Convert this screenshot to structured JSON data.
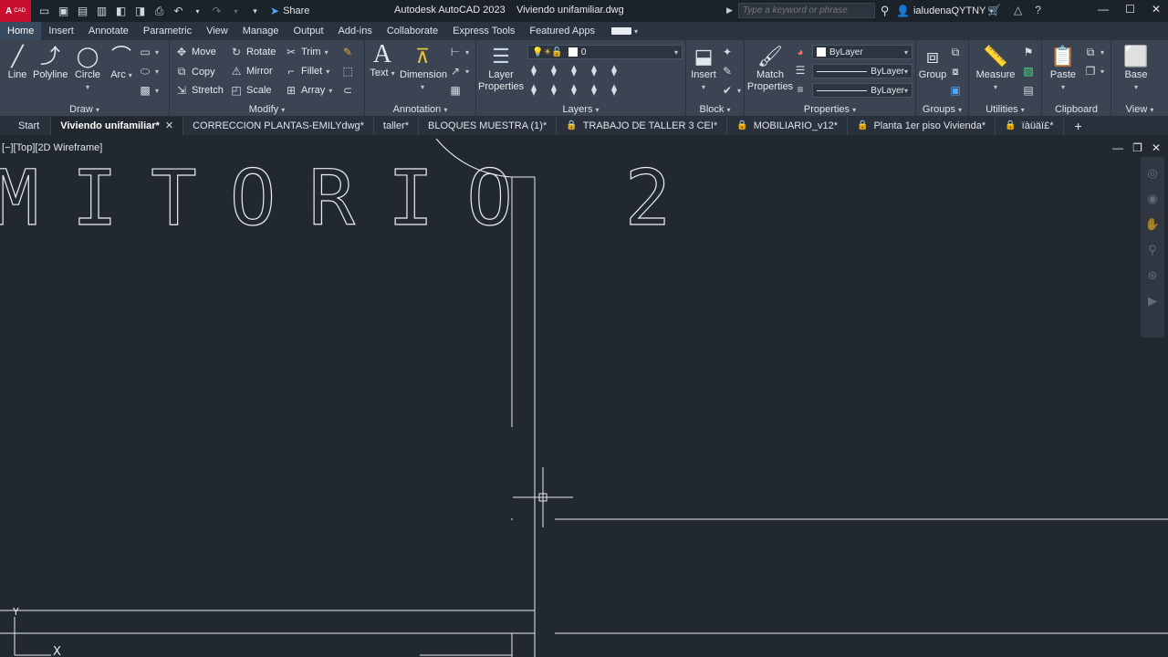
{
  "app": {
    "logo_letter": "A",
    "logo_sub": "CAD",
    "title": "Autodesk AutoCAD 2023",
    "file": "Viviendo unifamiliar.dwg",
    "share_label": "Share",
    "search_placeholder": "Type a keyword or phrase",
    "user": "ialudenaQYTNY"
  },
  "ribbon_tabs": [
    "Home",
    "Insert",
    "Annotate",
    "Parametric",
    "View",
    "Manage",
    "Output",
    "Add-ins",
    "Collaborate",
    "Express Tools",
    "Featured Apps"
  ],
  "draw": {
    "title": "Draw",
    "line": "Line",
    "polyline": "Polyline",
    "circle": "Circle",
    "arc": "Arc"
  },
  "modify": {
    "title": "Modify",
    "move": "Move",
    "rotate": "Rotate",
    "trim": "Trim",
    "copy": "Copy",
    "mirror": "Mirror",
    "fillet": "Fillet",
    "stretch": "Stretch",
    "scale": "Scale",
    "array": "Array"
  },
  "annotation": {
    "title": "Annotation",
    "text": "Text",
    "dimension": "Dimension"
  },
  "layers": {
    "title": "Layers",
    "layer_properties_1": "Layer",
    "layer_properties_2": "Properties",
    "current_layer": "0"
  },
  "block": {
    "title": "Block",
    "insert": "Insert"
  },
  "properties": {
    "title": "Properties",
    "match_1": "Match",
    "match_2": "Properties",
    "color": "ByLayer",
    "linetype": "ByLayer",
    "lineweight": "ByLayer"
  },
  "groups": {
    "title": "Groups",
    "group": "Group"
  },
  "utilities": {
    "title": "Utilities",
    "measure": "Measure"
  },
  "clipboard": {
    "title": "Clipboard",
    "paste": "Paste"
  },
  "view": {
    "title": "View",
    "base": "Base"
  },
  "file_tabs": {
    "start": "Start",
    "active": "Viviendo unifamiliar*",
    "t1": "CORRECCION PLANTAS-EMILYdwg*",
    "t2": "taller*",
    "t3": "BLOQUES MUESTRA (1)*",
    "t4": "TRABAJO DE TALLER 3 CEI*",
    "t5": "MOBILIARIO_v12*",
    "t6": "Planta 1er piso Vivienda*",
    "t7": "ïàüäï£*"
  },
  "viewport": {
    "label": "[−][Top][2D Wireframe]",
    "room_text": "MITORIO 2",
    "ucs_y": "Y",
    "ucs_x": "X"
  },
  "colors": {
    "canvas": "#212830",
    "ribbon": "#3b4453",
    "accent": "#4aa8ff"
  }
}
